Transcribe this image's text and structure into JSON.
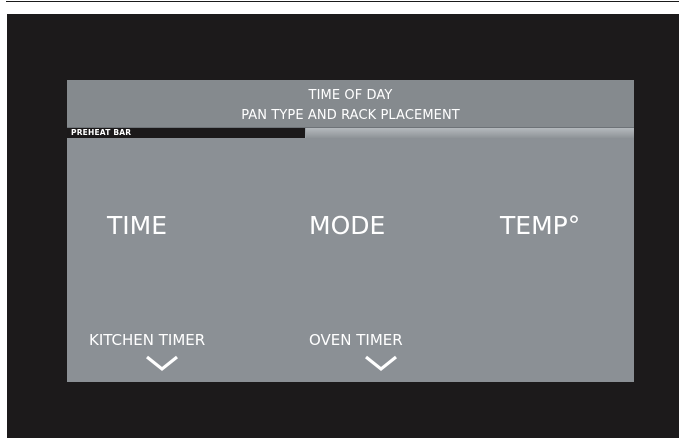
{
  "header": {
    "line1": "TIME OF DAY",
    "line2": "PAN TYPE AND RACK PLACEMENT"
  },
  "preheat": {
    "label": "PREHEAT BAR",
    "progress_fraction": 0.42
  },
  "main": {
    "time_label": "TIME",
    "mode_label": "MODE",
    "temp_label": "TEMP°"
  },
  "timers": {
    "kitchen_label": "KITCHEN  TIMER",
    "oven_label": "OVEN TIMER",
    "kitchen_icon": "chevron-down-icon",
    "oven_icon": "chevron-down-icon"
  },
  "colors": {
    "bezel": "#1c1a1b",
    "screen": "#8b9095",
    "text": "#ffffff",
    "preheat_fill": "#1b191a"
  }
}
